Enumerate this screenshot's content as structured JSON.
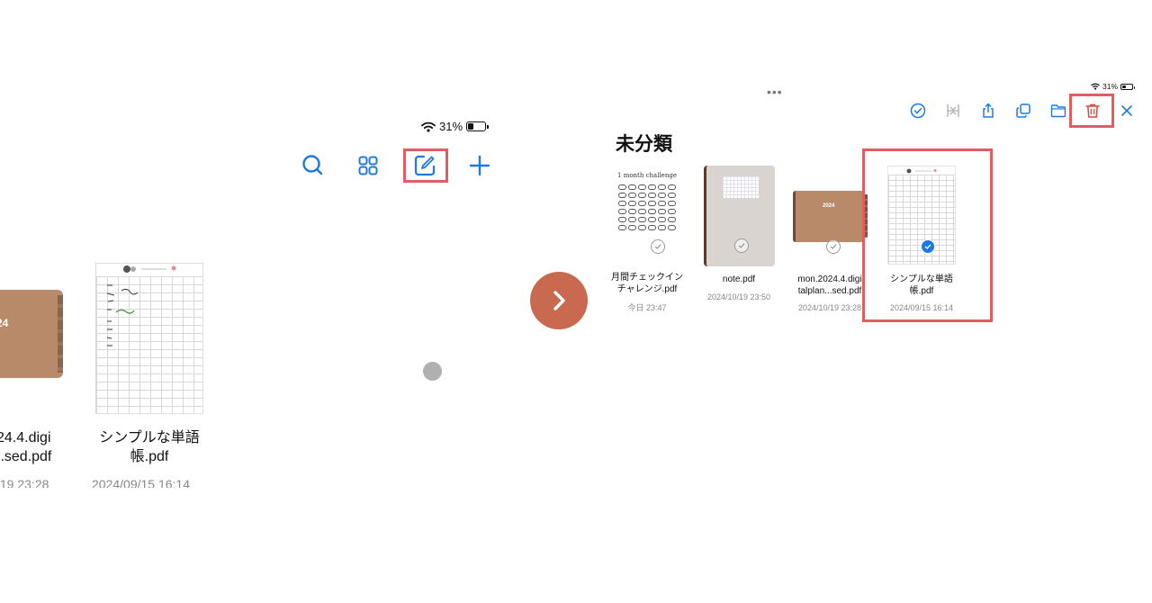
{
  "left_panel": {
    "status": {
      "battery_percent": "31%",
      "battery_level": 0.31
    },
    "toolbar": {
      "search_icon": "search-icon",
      "grid_icon": "grid-view-icon",
      "edit_icon": "edit-icon",
      "add_icon": "plus-icon"
    },
    "files": [
      {
        "name_line1": "24.4.digi",
        "name_line2": "..sed.pdf",
        "date": "/19 23:28",
        "thumb_year": "24"
      },
      {
        "name_line1": "シンプルな単語",
        "name_line2": "帳.pdf",
        "date": "2024/09/15 16:14"
      }
    ]
  },
  "right_panel": {
    "status": {
      "battery_percent": "31%",
      "battery_level": 0.31
    },
    "toolbar": {
      "icons": [
        "check-circle-icon",
        "merge-icon",
        "share-icon",
        "duplicate-icon",
        "folder-icon",
        "trash-icon",
        "close-icon"
      ]
    },
    "section_title": "未分類",
    "files": [
      {
        "name_line1": "月間チェックイン",
        "name_line2": "チャレンジ.pdf",
        "date": "今日 23:47",
        "thumb_title": "1 month challenge"
      },
      {
        "name_line1": "note.pdf",
        "name_line2": "",
        "date": "2024/10/19 23:50"
      },
      {
        "name_line1": "mon.2024.4.digi",
        "name_line2": "talplan...sed.pdf",
        "date": "2024/10/19 23:28",
        "thumb_year": "2024"
      },
      {
        "name_line1": "シンプルな単語",
        "name_line2": "帳.pdf",
        "date": "2024/09/15 16:14",
        "selected": true
      }
    ]
  },
  "colors": {
    "accent": "#1f7ae0",
    "highlight": "#e25d5d",
    "trash": "#e0443e",
    "next_button": "#c96a50",
    "planner_cover": "#b88a6a"
  }
}
